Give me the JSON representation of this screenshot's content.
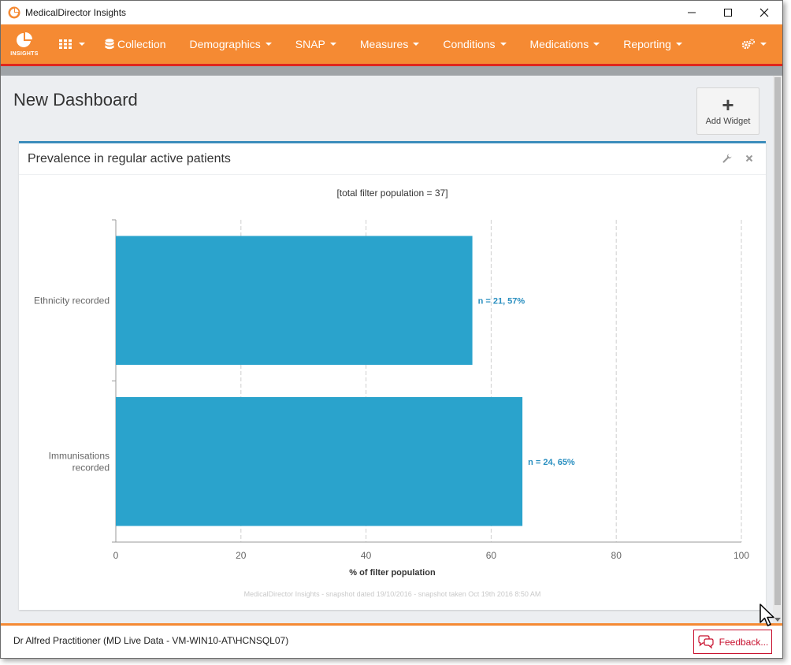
{
  "window": {
    "title": "MedicalDirector Insights"
  },
  "nav": {
    "logo_text": "INSIGHTS",
    "items": [
      "Collection",
      "Demographics",
      "SNAP",
      "Measures",
      "Conditions",
      "Medications",
      "Reporting"
    ]
  },
  "page": {
    "title": "New Dashboard",
    "add_widget_label": "Add Widget"
  },
  "widget": {
    "title": "Prevalence in regular active patients"
  },
  "chart_data": {
    "type": "bar",
    "orientation": "horizontal",
    "subtitle": "[total filter population = 37]",
    "categories": [
      "Ethnicity recorded",
      "Immunisations recorded"
    ],
    "values": [
      57,
      65
    ],
    "data_labels": [
      "n = 21, 57%",
      "n = 24, 65%"
    ],
    "xlabel": "% of filter population",
    "xlim": [
      0,
      100
    ],
    "xticks": [
      0,
      20,
      40,
      60,
      80,
      100
    ],
    "grid": true,
    "footnote": "MedicalDirector Insights - snapshot dated 19/10/2016 - snapshot taken Oct 19th 2016 8:50 AM",
    "colors": {
      "bar": "#2aa3cc",
      "label": "#2a8fc0"
    }
  },
  "footer": {
    "status": "Dr Alfred Practitioner (MD Live Data - VM-WIN10-AT\\HCNSQL07)",
    "feedback_label": "Feedback..."
  },
  "colors": {
    "nav": "#f58a33",
    "accent_red": "#e0261e",
    "feedback": "#c8102e"
  }
}
